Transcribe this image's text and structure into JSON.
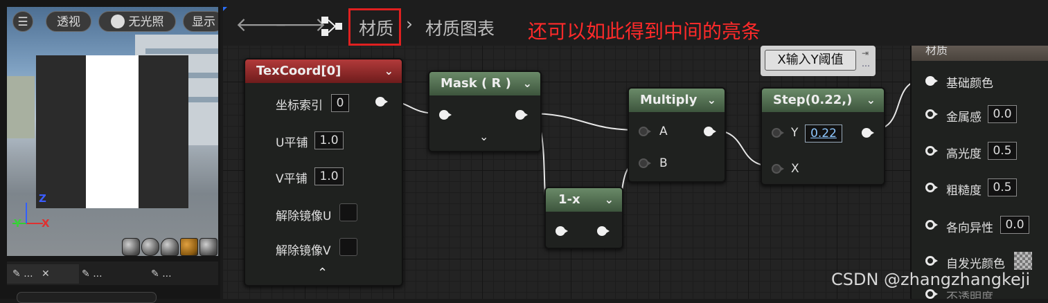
{
  "preview": {
    "menu_icon": "hamburger-icon",
    "perspective_label": "透视",
    "unlit_label": "无光照",
    "show_label": "显示",
    "axis_z": "Z",
    "axis_y": "Y",
    "axis_x": "X",
    "preview_shapes": [
      "cylinder-icon",
      "sphere-icon",
      "plane-icon",
      "cube-icon",
      "mesh-icon"
    ],
    "tabs": [
      {
        "label": "...",
        "close": "✕"
      },
      {
        "label": "..."
      },
      {
        "label": "..."
      }
    ]
  },
  "toolbar": {
    "back_icon": "arrow-left-icon",
    "forward_icon": "arrow-right-icon",
    "graph_icon": "graph-icon",
    "breadcrumb_1": "材质",
    "separator": "›",
    "breadcrumb_2": "材质图表",
    "annotation": "还可以如此得到中间的亮条"
  },
  "nodes": {
    "texcoord": {
      "title": "TexCoord[0]",
      "coord_index_label": "坐标索引",
      "coord_index_value": "0",
      "u_tiling_label": "U平铺",
      "u_tiling_value": "1.0",
      "v_tiling_label": "V平铺",
      "v_tiling_value": "1.0",
      "unmirror_u_label": "解除镜像U",
      "unmirror_v_label": "解除镜像V"
    },
    "mask": {
      "title": "Mask ( R )"
    },
    "oneminus": {
      "title": "1-x"
    },
    "multiply": {
      "title": "Multiply",
      "pin_a": "A",
      "pin_b": "B"
    },
    "step": {
      "title": "Step(0.22,)",
      "pin_y": "Y",
      "y_value": "0.22",
      "pin_x": "X"
    },
    "comment": {
      "text": "X输入Y阈值"
    }
  },
  "material_result": {
    "title": "材质",
    "base_color_label": "基础颜色",
    "metallic_label": "金属感",
    "metallic_value": "0.0",
    "specular_label": "高光度",
    "specular_value": "0.5",
    "roughness_label": "粗糙度",
    "roughness_value": "0.5",
    "anisotropy_label": "各向异性",
    "anisotropy_value": "0.0",
    "emissive_label": "自发光颜色",
    "opacity_label": "不透明度"
  },
  "watermark": "CSDN @zhangzhangkeji"
}
